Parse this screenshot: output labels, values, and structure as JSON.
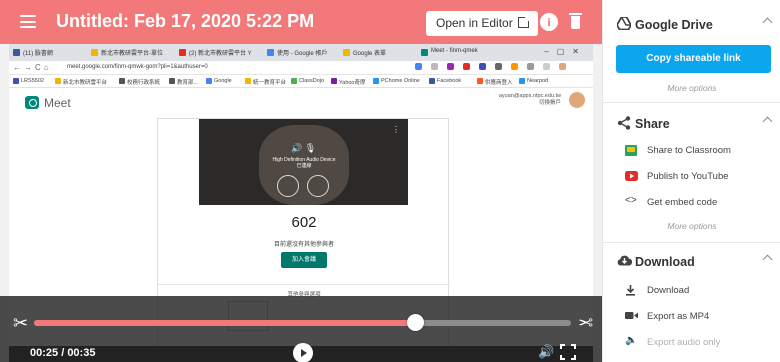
{
  "header": {
    "title": "Untitled: Feb 17, 2020 5:22 PM",
    "open_editor_label": "Open in Editor",
    "accent_color": "#f2787a"
  },
  "browser": {
    "tabs": [
      {
        "label": "(11) 臉書網"
      },
      {
        "label": "新北市教研雲平台-單位"
      },
      {
        "label": "(2) 新北市教研雲平台 Y"
      },
      {
        "label": "使用 - Google 帳戶"
      },
      {
        "label": "Google 表單"
      },
      {
        "label": "Meet - finm-qmek"
      }
    ],
    "url": "meet.google.com/finm-qmwk-gom?pli=1&authuser=0",
    "bookmarks": [
      {
        "label": "LRS5502"
      },
      {
        "label": "新北市教研雲平台"
      },
      {
        "label": "校務行政系統"
      },
      {
        "label": "教育部..."
      },
      {
        "label": "Google"
      },
      {
        "label": "統一教育平台"
      },
      {
        "label": "ClassDojo"
      },
      {
        "label": "Yahoo奇摩"
      },
      {
        "label": "PChome Online"
      },
      {
        "label": "Facebook"
      },
      {
        "label": "供應商登入"
      },
      {
        "label": "Nearpod"
      }
    ],
    "meet_name": "Meet",
    "account_email": "ayuan@apps.ntpc.edu.tw",
    "account_switch": "切換帳戶",
    "device_text": "High Definition Audio Device",
    "device_subtext": "已連線",
    "meeting_code": "602",
    "no_one_here": "目前還沒有其他參與者",
    "join_label": "加入會議",
    "other_options": "其他參與選項"
  },
  "player": {
    "current_time": "00:25",
    "total_time": "00:35",
    "progress_fraction": 0.71
  },
  "sidebar": {
    "drive": {
      "title": "Google Drive",
      "copy_link_label": "Copy shareable link",
      "more_options": "More options"
    },
    "share": {
      "title": "Share",
      "items": [
        {
          "label": "Share to Classroom",
          "icon": "classroom-icon",
          "color": "#2aa25a"
        },
        {
          "label": "Publish to YouTube",
          "icon": "youtube-icon",
          "color": "#e52d27"
        },
        {
          "label": "Get embed code",
          "icon": "code-icon",
          "color": "#444444"
        }
      ],
      "more_options": "More options"
    },
    "download": {
      "title": "Download",
      "items": [
        {
          "label": "Download",
          "icon": "download-icon"
        },
        {
          "label": "Export as MP4",
          "icon": "video-camera-icon"
        },
        {
          "label": "Export audio only",
          "icon": "speaker-icon",
          "disabled": true
        }
      ]
    }
  }
}
